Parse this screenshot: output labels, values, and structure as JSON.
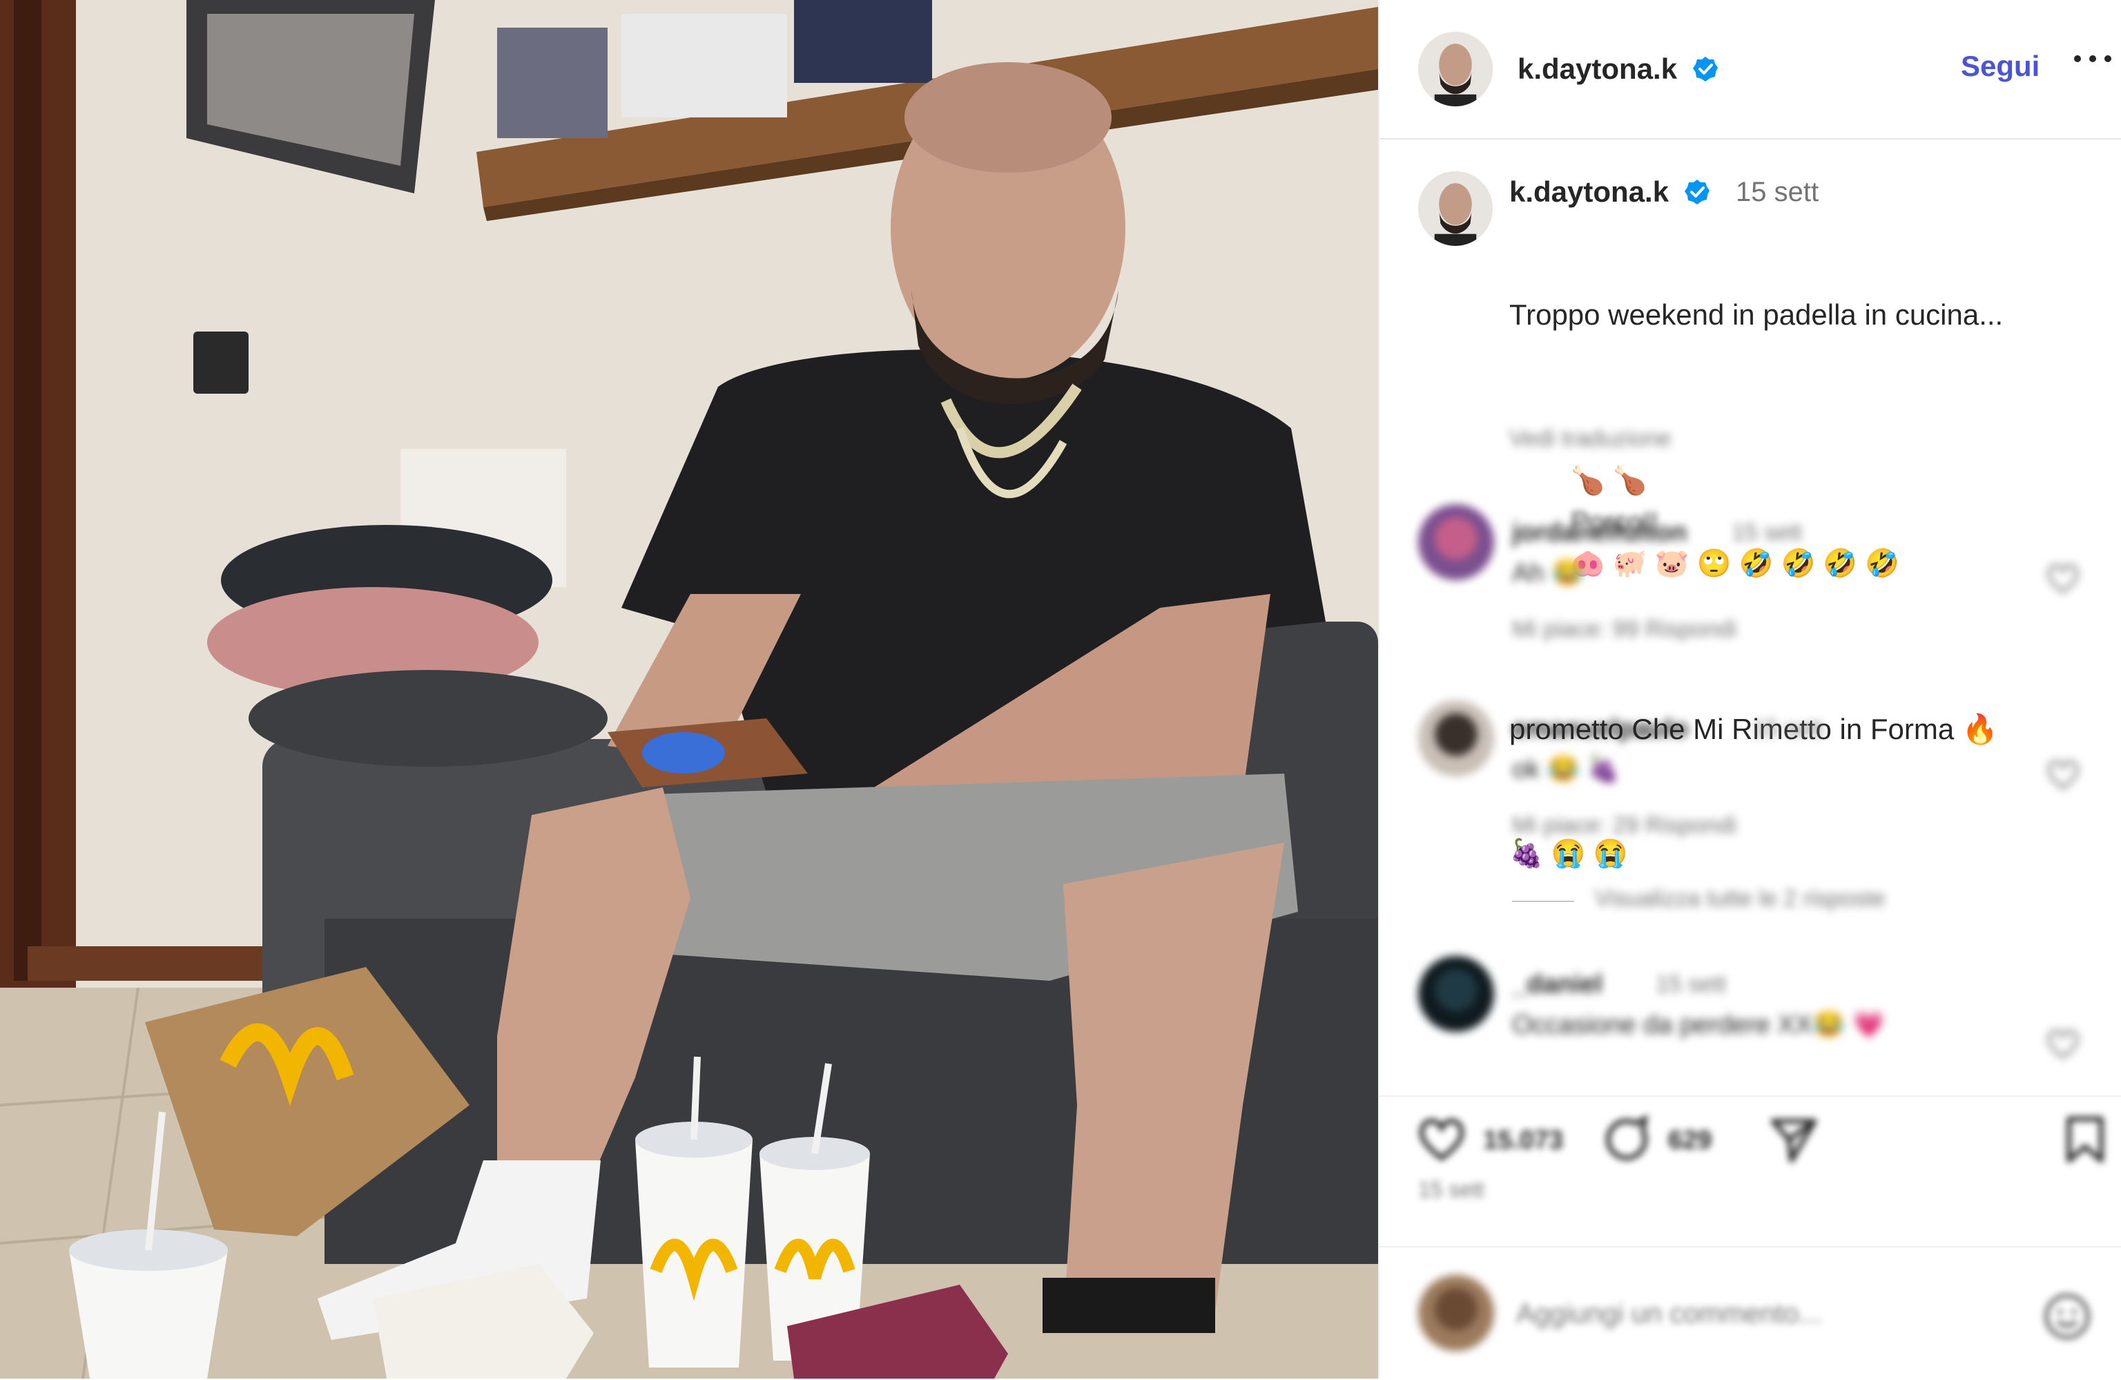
{
  "post": {
    "username": "k.daytona.k",
    "follow_label": "Segui",
    "caption_time": "15 sett",
    "caption_line1": "Troppo weekend in padella in cucina...",
    "caption_line2_visible": "🍗 🍗",
    "caption_line2_blurred": "Porco!!",
    "caption_line2_end": "🐽 🐖 🐷 🙄 🤣 🤣 🤣 🤣",
    "caption_line3": "prometto Che Mi Rimetto in Forma 🔥",
    "caption_line4": "🍇 😭 😭",
    "see_translation": "Vedi traduzione"
  },
  "comments": [
    {
      "user": "jordanelfulton",
      "time": "15 sett",
      "text": "Ah 😂",
      "meta": "Mi piace: 99   Rispondi"
    },
    {
      "user": "emanuelpaulo",
      "time": "15 sett",
      "text": "ok 😂 🍇",
      "meta": "Mi piace: 29   Rispondi"
    },
    {
      "user": "_daniel",
      "time": "15 sett",
      "text": "Occasione da perdere XX😂 💗",
      "meta": ""
    }
  ],
  "view_replies": "Visualizza tutte le 2 risposte",
  "actions": {
    "likes_count": "15.073",
    "comments_count": "629",
    "date": "15 sett"
  },
  "comment_input": {
    "placeholder": "Aggiungi un commento..."
  },
  "colors": {
    "link_blue": "#4b55d0",
    "verified_blue": "#0095f6",
    "secondary_text": "#737373"
  },
  "icons": [
    "verified-badge-icon",
    "more-options-icon",
    "heart-icon",
    "comment-icon",
    "share-icon",
    "bookmark-icon",
    "emoji-icon"
  ]
}
